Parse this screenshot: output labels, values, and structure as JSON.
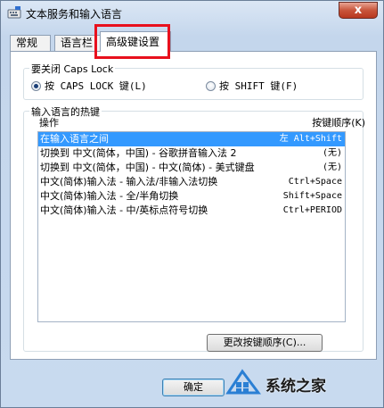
{
  "window": {
    "title": "文本服务和输入语言",
    "close_glyph": "x"
  },
  "tabs": [
    {
      "label": "常规"
    },
    {
      "label": "语言栏"
    },
    {
      "label": "高级键设置",
      "active": true
    }
  ],
  "caps_lock": {
    "group_label": "要关闭 Caps Lock",
    "options": [
      {
        "label": "按 CAPS LOCK 键(L)",
        "selected": true
      },
      {
        "label": "按 SHIFT 键(F)",
        "selected": false
      }
    ]
  },
  "hotkeys": {
    "group_label": "输入语言的热键",
    "column_action": "操作",
    "column_keys": "按键顺序(K)",
    "rows": [
      {
        "action": "在输入语言之间",
        "keys": "左 Alt+Shift",
        "selected": true
      },
      {
        "action": "切换到 中文(简体，中国) - 谷歌拼音输入法 2",
        "keys": "(无)"
      },
      {
        "action": "切换到 中文(简体，中国) - 中文(简体) - 美式键盘",
        "keys": "(无)"
      },
      {
        "action": "中文(简体)输入法 - 输入法/非输入法切换",
        "keys": "Ctrl+Space"
      },
      {
        "action": "中文(简体)输入法 - 全/半角切换",
        "keys": "Shift+Space"
      },
      {
        "action": "中文(简体)输入法 - 中/英标点符号切换",
        "keys": "Ctrl+PERIOD"
      }
    ],
    "change_button": "更改按键顺序(C)..."
  },
  "footer": {
    "ok_button": "确定"
  },
  "watermark": {
    "text": "系统之家"
  },
  "colors": {
    "highlight_box": "#e8101d",
    "selection": "#3399ff",
    "close_button": "#c9553b"
  }
}
